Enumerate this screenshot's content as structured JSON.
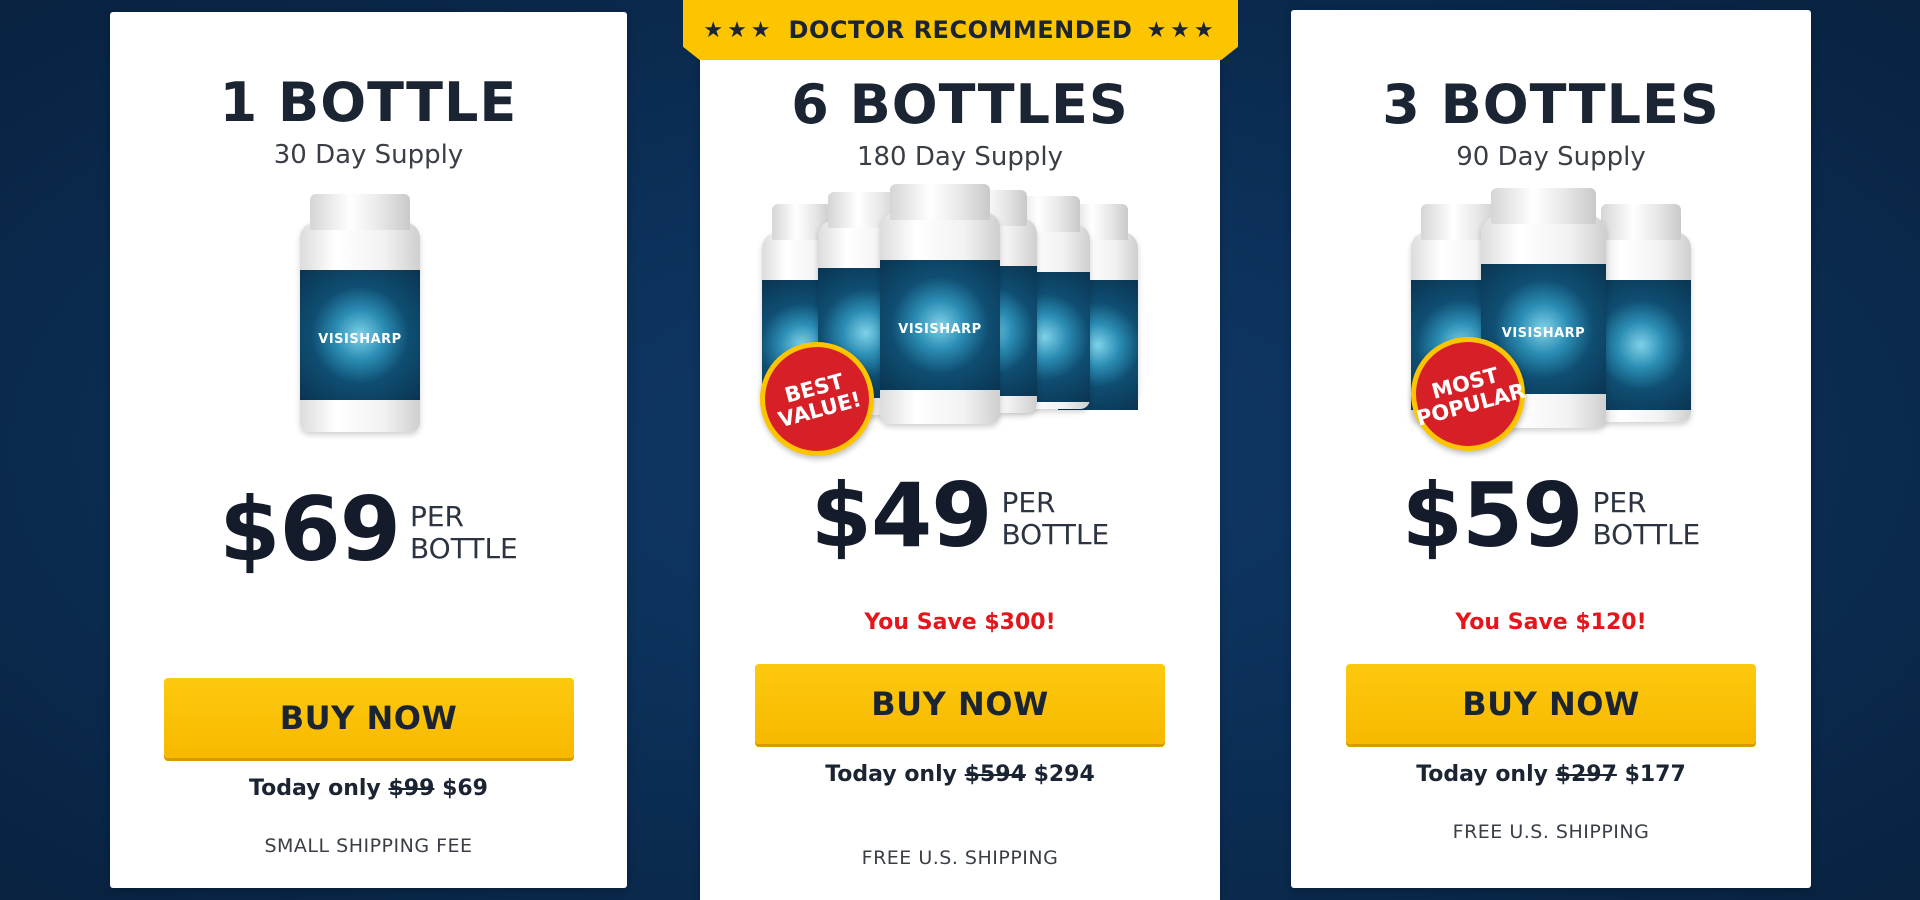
{
  "ribbon": {
    "stars_left": "★★★",
    "label": "DOCTOR RECOMMENDED",
    "stars_right": "★★★"
  },
  "product_brand": "VISISHARP",
  "packages": [
    {
      "title": "1 BOTTLE",
      "supply": "30 Day Supply",
      "bottle_count_shown": 1,
      "badge": "",
      "price": "$69",
      "per_line1": "PER",
      "per_line2": "BOTTLE",
      "savings": "",
      "buy_label": "BUY NOW",
      "today_prefix": "Today only",
      "old_price": "$99",
      "new_price": "$69",
      "shipping": "SMALL SHIPPING FEE"
    },
    {
      "title": "6 BOTTLES",
      "supply": "180 Day Supply",
      "bottle_count_shown": 6,
      "badge": "BEST VALUE!",
      "price": "$49",
      "per_line1": "PER",
      "per_line2": "BOTTLE",
      "savings": "You Save $300!",
      "buy_label": "BUY NOW",
      "today_prefix": "Today only",
      "old_price": "$594",
      "new_price": "$294",
      "shipping": "FREE U.S. SHIPPING"
    },
    {
      "title": "3 BOTTLES",
      "supply": "90 Day Supply",
      "bottle_count_shown": 3,
      "badge": "MOST POPULAR",
      "price": "$59",
      "per_line1": "PER",
      "per_line2": "BOTTLE",
      "savings": "You Save $120!",
      "buy_label": "BUY NOW",
      "today_prefix": "Today only",
      "old_price": "$297",
      "new_price": "$177",
      "shipping": "FREE U.S. SHIPPING"
    }
  ],
  "colors": {
    "background": "#0d2f57",
    "button": "#fcc500",
    "savings": "#e3161c",
    "badge": "#d61f26"
  }
}
